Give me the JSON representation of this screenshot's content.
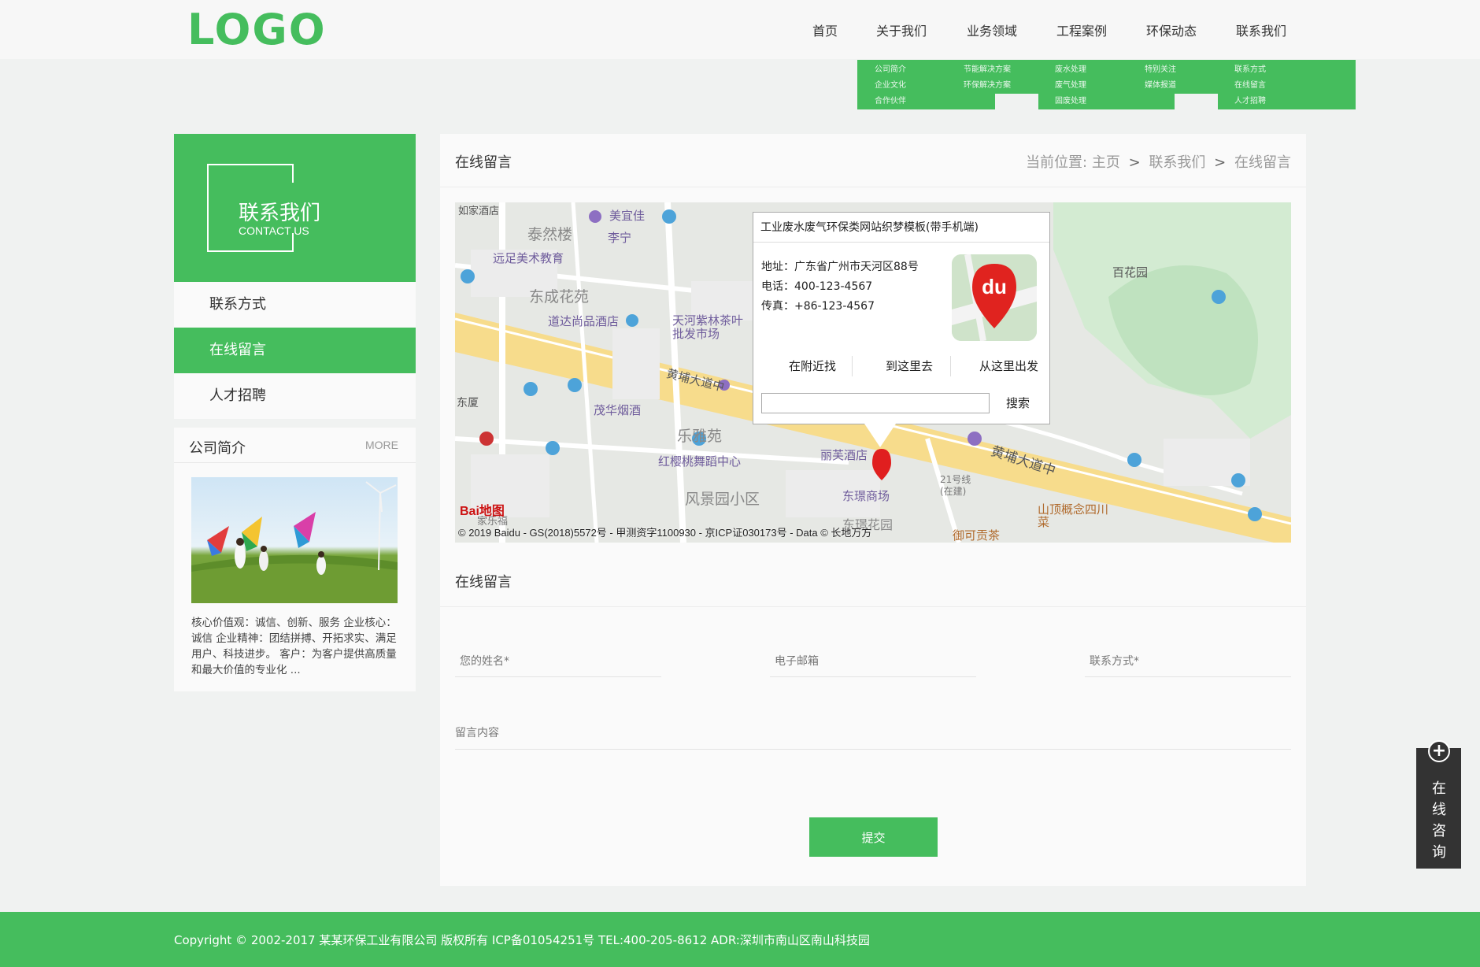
{
  "header": {
    "logo": "LOGO",
    "nav": [
      "首页",
      "关于我们",
      "业务领域",
      "工程案例",
      "环保动态",
      "联系我们"
    ],
    "dropdowns": [
      [
        "公司简介",
        "企业文化",
        "合作伙伴"
      ],
      [
        "节能解决方案",
        "环保解决方案"
      ],
      [
        "废水处理",
        "废气处理",
        "固废处理"
      ],
      [
        "特别关注",
        "媒体报道"
      ],
      [
        "联系方式",
        "在线留言",
        "人才招聘"
      ]
    ]
  },
  "sidebar": {
    "title": "联系我们",
    "subtitle": "CONTACT US",
    "items": [
      "联系方式",
      "在线留言",
      "人才招聘"
    ],
    "active_index": 1,
    "box": {
      "title": "公司简介",
      "more": "MORE",
      "text": "核心价值观：诚信、创新、服务 企业核心：诚信 企业精神：团结拼搏、开拓求实、满足用户、科技进步。 客户：为客户提供高质量和最大价值的专业化 ..."
    }
  },
  "main": {
    "title": "在线留言",
    "breadcrumb": {
      "prefix": "当前位置:",
      "home": "主页",
      "sep": ">",
      "parent": "联系我们",
      "current": "在线留言"
    }
  },
  "map": {
    "infowindow": {
      "title": "工业废水废气环保类网站织梦模板(带手机端)",
      "address": "地址：广东省广州市天河区88号",
      "phone": "电话：400-123-4567",
      "fax": "传真：+86-123-4567",
      "actions": [
        "在附近找",
        "到这里去",
        "从这里出发"
      ],
      "search": "搜索"
    },
    "labels": [
      "如家酒店",
      "美宜佳",
      "泰然楼",
      "李宁",
      "远足美术教育",
      "东成花苑",
      "道达尚品酒店",
      "天河紫林茶叶批发市场",
      "黄埔大道中",
      "茂华烟酒",
      "乐雅苑",
      "红樱桃舞蹈中心",
      "丽芙酒店",
      "东璟商场",
      "风景园小区",
      "东璟花园",
      "百花园",
      "黄埔大道中",
      "21号线(在建)",
      "山顶概念四川菜",
      "御可贡茶",
      "家乐福",
      "东厦"
    ],
    "copyright": "© 2019 Baidu - GS(2018)5572号 - 甲测资字1100930 - 京ICP证030173号 - Data © 长地万方",
    "brand": "Bai地图"
  },
  "form": {
    "title": "在线留言",
    "name_placeholder": "您的姓名*",
    "email_placeholder": "电子邮箱",
    "phone_placeholder": "联系方式*",
    "message_placeholder": "留言内容",
    "submit": "提交"
  },
  "footer": {
    "text": "Copyright © 2002-2017 某某环保工业有限公司 版权所有   ICP备01054251号 TEL:400-205-8612 ADR:深圳市南山区南山科技园"
  },
  "consult": {
    "label": "在线咨询",
    "icon": "plus-icon"
  },
  "colors": {
    "accent": "#45bd5d",
    "dark": "#333333",
    "bg": "#f0f2f1"
  }
}
